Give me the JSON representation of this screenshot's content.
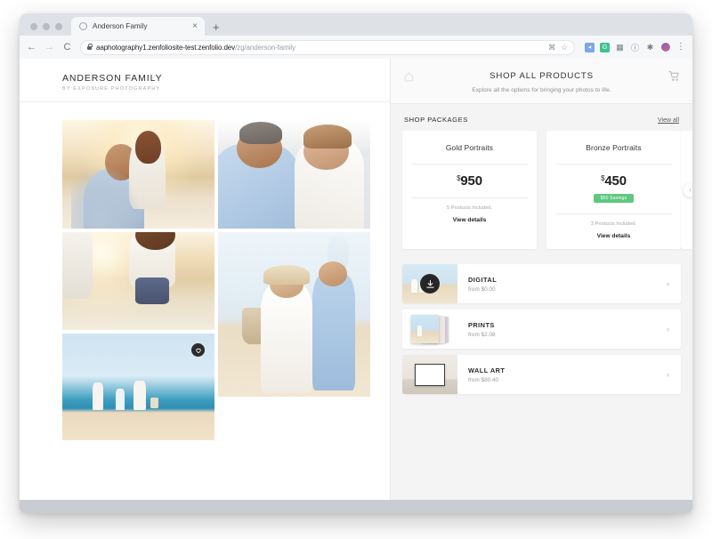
{
  "browser": {
    "tab": {
      "title": "Anderson Family",
      "close_label": "×",
      "favicon": "loading-circle-icon"
    },
    "new_tab_label": "+",
    "nav": {
      "back": "←",
      "forward": "→",
      "reload": "C"
    },
    "address": {
      "domain": "aaphotography1.zenfoliosite-test.zenfolio.dev",
      "path": "/zg/anderson-family"
    },
    "omnibox_icons": [
      "command-icon",
      "bookmark-star-icon"
    ],
    "extensions": [
      "cursor-extension-icon",
      "grammarly-extension-icon",
      "grid-extension-icon",
      "info-extension-icon",
      "puzzle-extension-icon"
    ],
    "profile": "user-avatar",
    "menu_label": "⋮"
  },
  "site": {
    "title": "ANDERSON FAMILY",
    "subtitle": "BY EXPOSURE PHOTOGRAPHY"
  },
  "gallery": {
    "photos": [
      {
        "alt": "father lifting daughter at sunset beach"
      },
      {
        "alt": "father kissing daughter on the head"
      },
      {
        "alt": "girl running on sand holding hand"
      },
      {
        "alt": "family walking on beach holding hands"
      },
      {
        "alt": "family posing with picnic basket"
      }
    ],
    "favorite_label": "♡"
  },
  "shop": {
    "home_label": "home-icon",
    "cart_label": "cart-icon",
    "title": "SHOP ALL PRODUCTS",
    "subtitle": "Explore all the options for bringing your photos to life.",
    "packages_section": {
      "title": "SHOP PACKAGES",
      "view_all": "View all",
      "next_label": "›",
      "cards": [
        {
          "name": "Gold Portraits",
          "currency": "$",
          "price": "950",
          "badge": "",
          "included": "5 Products Included.",
          "cta": "View details"
        },
        {
          "name": "Bronze Portraits",
          "currency": "$",
          "price": "450",
          "badge": "$50 Savings",
          "included": "3 Products Included.",
          "cta": "View details"
        }
      ]
    },
    "products": [
      {
        "name": "DIGITAL",
        "from": "from $0.00",
        "chevron": "›",
        "thumb": "digital-download-thumb"
      },
      {
        "name": "PRINTS",
        "from": "from $2.08",
        "chevron": "›",
        "thumb": "print-stack-thumb"
      },
      {
        "name": "WALL ART",
        "from": "from $80.40",
        "chevron": "›",
        "thumb": "framed-wall-art-thumb"
      }
    ]
  },
  "colors": {
    "badge_green": "#5fc87f",
    "panel_bg": "#f4f4f4",
    "card_bg": "#ffffff"
  }
}
